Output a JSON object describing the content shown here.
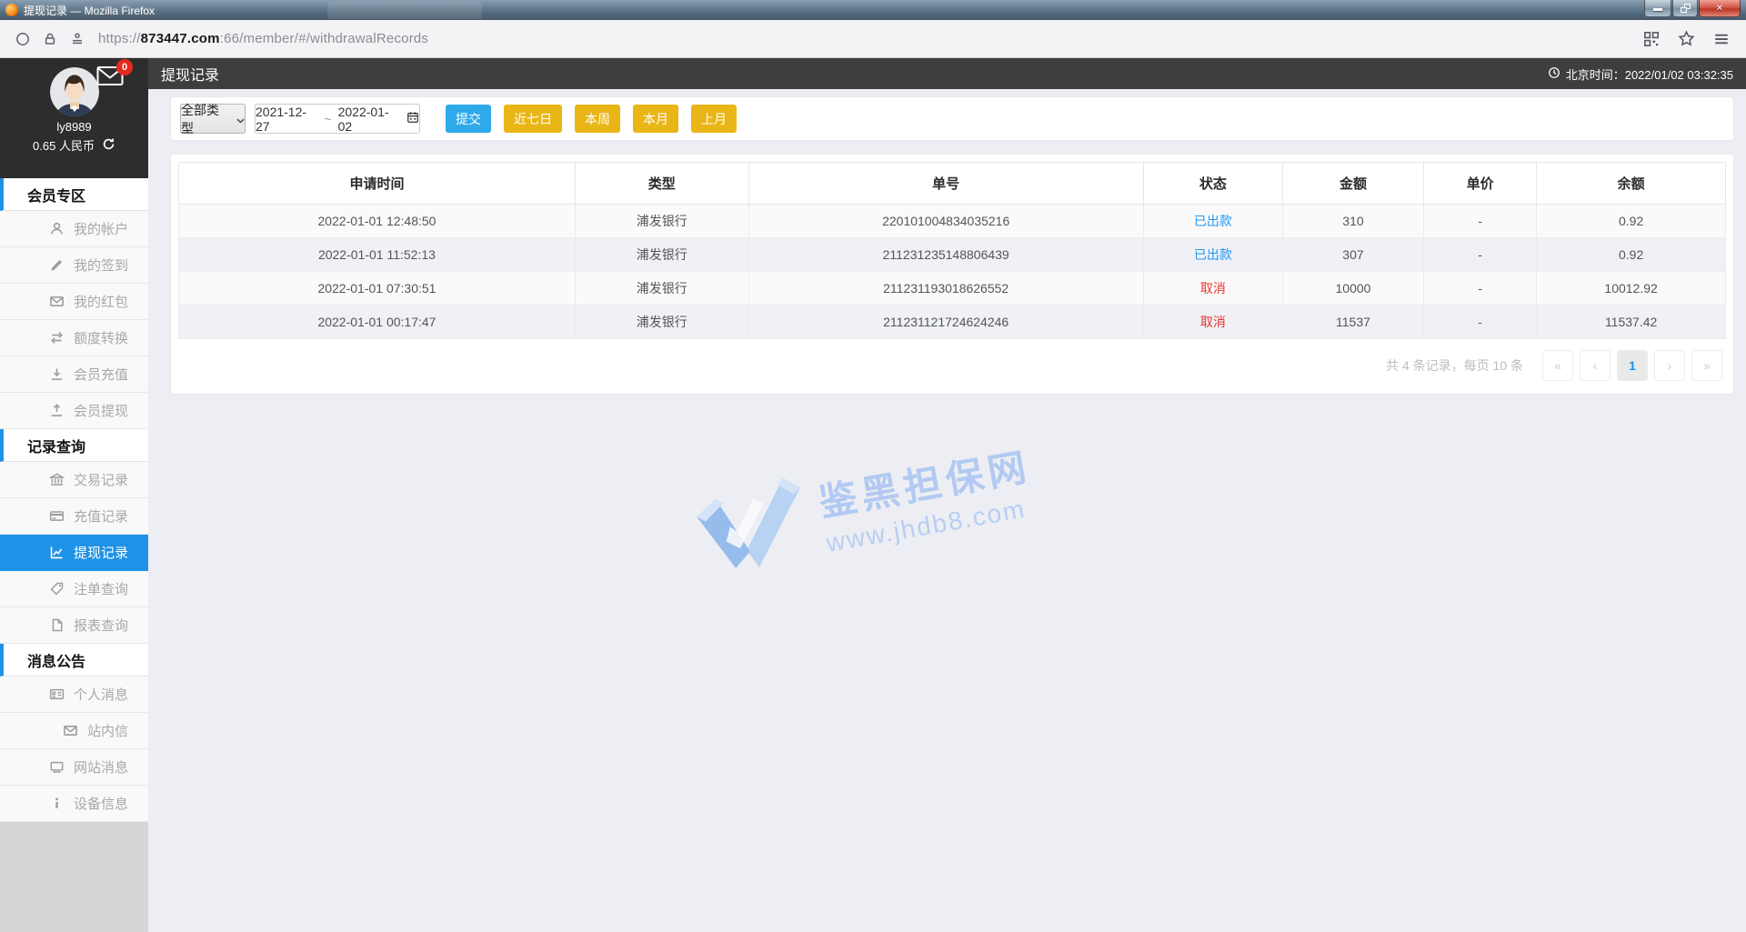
{
  "browser": {
    "window_title": "提现记录 — Mozilla Firefox",
    "url": {
      "protocol": "https://",
      "domain": "873447.com",
      "path": ":66/member/#/withdrawalRecords"
    }
  },
  "topbar": {
    "title": "提现记录",
    "clock_label": "北京时间：2022/01/02 03:32:35"
  },
  "user_panel": {
    "username": "ly8989",
    "balance": "0.65 人民币",
    "badge": "0"
  },
  "sidebar": {
    "sections": [
      {
        "title": "会员专区",
        "items": [
          {
            "label": "我的帐户"
          },
          {
            "label": "我的签到"
          },
          {
            "label": "我的红包"
          },
          {
            "label": "额度转换"
          },
          {
            "label": "会员充值"
          },
          {
            "label": "会员提现"
          }
        ]
      },
      {
        "title": "记录查询",
        "items": [
          {
            "label": "交易记录"
          },
          {
            "label": "充值记录"
          },
          {
            "label": "提现记录",
            "active": true
          },
          {
            "label": "注单查询"
          },
          {
            "label": "报表查询"
          }
        ]
      },
      {
        "title": "消息公告",
        "items": [
          {
            "label": "个人消息"
          },
          {
            "label": "站内信"
          },
          {
            "label": "网站消息"
          },
          {
            "label": "设备信息"
          }
        ]
      }
    ]
  },
  "filters": {
    "type_select": "全部类型",
    "date_range": {
      "start": "2021-12-27",
      "separator": "~",
      "end": "2022-01-02"
    },
    "submit_label": "提交",
    "quick_buttons": [
      "近七日",
      "本周",
      "本月",
      "上月"
    ]
  },
  "table": {
    "columns": [
      "申请时间",
      "类型",
      "单号",
      "状态",
      "金额",
      "单价",
      "余额"
    ],
    "rows": [
      {
        "time": "2022-01-01 12:48:50",
        "type": "浦发银行",
        "order_no": "220101004834035216",
        "status": "已出款",
        "status_type": "paid",
        "amount": "310",
        "unit_price": "-",
        "balance": "0.92"
      },
      {
        "time": "2022-01-01 11:52:13",
        "type": "浦发银行",
        "order_no": "211231235148806439",
        "status": "已出款",
        "status_type": "paid",
        "amount": "307",
        "unit_price": "-",
        "balance": "0.92"
      },
      {
        "time": "2022-01-01 07:30:51",
        "type": "浦发银行",
        "order_no": "211231193018626552",
        "status": "取消",
        "status_type": "cancel",
        "amount": "10000",
        "unit_price": "-",
        "balance": "10012.92"
      },
      {
        "time": "2022-01-01 00:17:47",
        "type": "浦发银行",
        "order_no": "211231121724624246",
        "status": "取消",
        "status_type": "cancel",
        "amount": "11537",
        "unit_price": "-",
        "balance": "11537.42"
      }
    ]
  },
  "pagination": {
    "summary": "共 4 条记录，每页 10 条",
    "first": "«",
    "prev": "‹",
    "current_page": "1",
    "next": "›",
    "last": "»"
  },
  "watermark": {
    "site_name": "鉴黑担保网",
    "site_url": "www.jhdb8.com"
  },
  "colors": {
    "accent_blue": "#1d92e6",
    "status_paid": "#2196f3",
    "status_cancel": "#e8342c",
    "button_yellow": "#e9b517",
    "button_blue": "#2fa9ea",
    "header_dark": "#3e3e3e"
  }
}
